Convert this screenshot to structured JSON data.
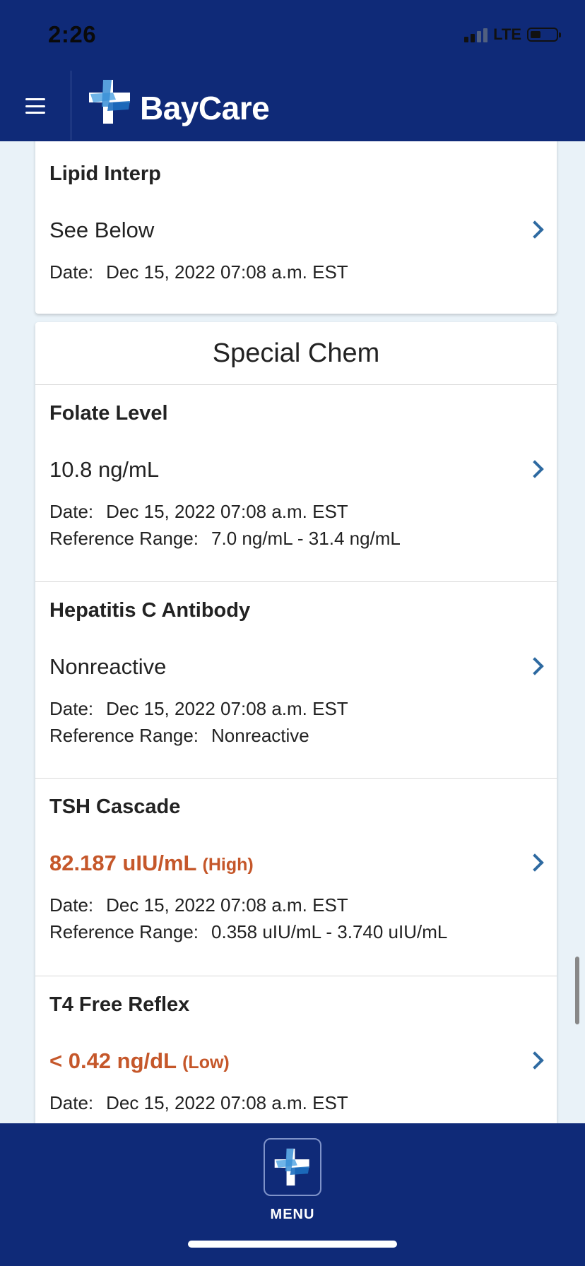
{
  "status_bar": {
    "time": "2:26",
    "network": "LTE"
  },
  "header": {
    "brand": "BayCare",
    "icons": [
      "hamburger-menu-icon",
      "baycare-cross-logo"
    ]
  },
  "card_lipid": {
    "title": "Lipid Interp",
    "value": "See Below",
    "date_label": "Date:",
    "date": "Dec 15, 2022 07:08 a.m. EST"
  },
  "special_chem": {
    "section_title": "Special Chem",
    "items": [
      {
        "title": "Folate Level",
        "value": "10.8 ng/mL",
        "flag": "",
        "date_label": "Date:",
        "date": "Dec 15, 2022 07:08 a.m. EST",
        "ref_label": "Reference Range:",
        "ref": "7.0 ng/mL - 31.4 ng/mL"
      },
      {
        "title": "Hepatitis C Antibody",
        "value": "Nonreactive",
        "flag": "",
        "date_label": "Date:",
        "date": "Dec 15, 2022 07:08 a.m. EST",
        "ref_label": "Reference Range:",
        "ref": "Nonreactive"
      },
      {
        "title": "TSH Cascade",
        "value": "82.187 uIU/mL",
        "flag": "(High)",
        "date_label": "Date:",
        "date": "Dec 15, 2022 07:08 a.m. EST",
        "ref_label": "Reference Range:",
        "ref": "0.358 uIU/mL - 3.740 uIU/mL"
      },
      {
        "title": "T4 Free Reflex",
        "value": "< 0.42 ng/dL",
        "flag": "(Low)",
        "date_label": "Date:",
        "date": "Dec 15, 2022 07:08 a.m. EST"
      }
    ]
  },
  "bottom_bar": {
    "menu_label": "MENU"
  },
  "colors": {
    "header_bg": "#0f2a78",
    "page_bg": "#e9f2f8",
    "abnormal": "#c5572a",
    "chevron": "#2e6aa1"
  }
}
